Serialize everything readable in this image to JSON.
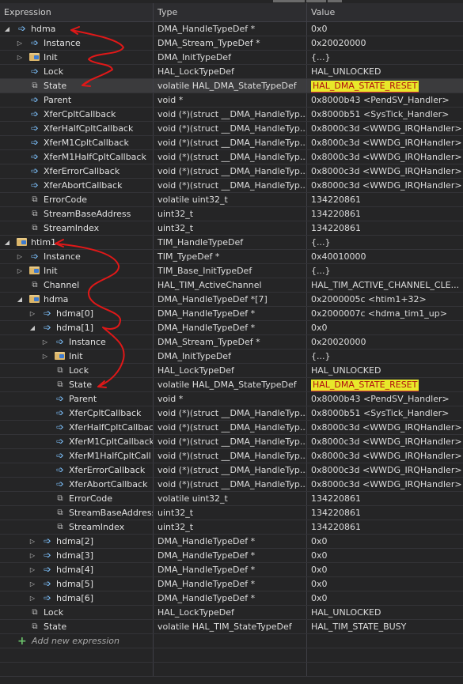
{
  "headers": {
    "expression": "Expression",
    "type": "Type",
    "value": "Value"
  },
  "add_new_expression": "Add new expression",
  "rows": [
    {
      "depth": 0,
      "exp": "open",
      "icon": "pointer",
      "name": "hdma",
      "type": "DMA_HandleTypeDef *",
      "value": "0x0"
    },
    {
      "depth": 1,
      "exp": "closed",
      "icon": "pointer",
      "name": "Instance",
      "type": "DMA_Stream_TypeDef *",
      "value": "0x20020000"
    },
    {
      "depth": 1,
      "exp": "closed",
      "icon": "struct",
      "name": "Init",
      "type": "DMA_InitTypeDef",
      "value": "{...}"
    },
    {
      "depth": 1,
      "exp": "none",
      "icon": "pointer",
      "name": "Lock",
      "type": "HAL_LockTypeDef",
      "value": "HAL_UNLOCKED"
    },
    {
      "depth": 1,
      "exp": "none",
      "icon": "field",
      "name": "State",
      "type": "volatile HAL_DMA_StateTypeDef",
      "value": "HAL_DMA_STATE_RESET",
      "selected": true,
      "highlight": true
    },
    {
      "depth": 1,
      "exp": "none",
      "icon": "pointer",
      "name": "Parent",
      "type": "void *",
      "value": "0x8000b43 <PendSV_Handler>"
    },
    {
      "depth": 1,
      "exp": "none",
      "icon": "pointer",
      "name": "XferCpltCallback",
      "type": "void (*)(struct __DMA_HandleTyp...",
      "value": "0x8000b51 <SysTick_Handler>"
    },
    {
      "depth": 1,
      "exp": "none",
      "icon": "pointer",
      "name": "XferHalfCpltCallback",
      "type": "void (*)(struct __DMA_HandleTyp...",
      "value": "0x8000c3d <WWDG_IRQHandler>"
    },
    {
      "depth": 1,
      "exp": "none",
      "icon": "pointer",
      "name": "XferM1CpltCallback",
      "type": "void (*)(struct __DMA_HandleTyp...",
      "value": "0x8000c3d <WWDG_IRQHandler>"
    },
    {
      "depth": 1,
      "exp": "none",
      "icon": "pointer",
      "name": "XferM1HalfCpltCallback",
      "type": "void (*)(struct __DMA_HandleTyp...",
      "value": "0x8000c3d <WWDG_IRQHandler>"
    },
    {
      "depth": 1,
      "exp": "none",
      "icon": "pointer",
      "name": "XferErrorCallback",
      "type": "void (*)(struct __DMA_HandleTyp...",
      "value": "0x8000c3d <WWDG_IRQHandler>"
    },
    {
      "depth": 1,
      "exp": "none",
      "icon": "pointer",
      "name": "XferAbortCallback",
      "type": "void (*)(struct __DMA_HandleTyp...",
      "value": "0x8000c3d <WWDG_IRQHandler>"
    },
    {
      "depth": 1,
      "exp": "none",
      "icon": "field",
      "name": "ErrorCode",
      "type": "volatile uint32_t",
      "value": "134220861"
    },
    {
      "depth": 1,
      "exp": "none",
      "icon": "field",
      "name": "StreamBaseAddress",
      "type": "uint32_t",
      "value": "134220861"
    },
    {
      "depth": 1,
      "exp": "none",
      "icon": "field",
      "name": "StreamIndex",
      "type": "uint32_t",
      "value": "134220861"
    },
    {
      "depth": 0,
      "exp": "open",
      "icon": "struct",
      "name": "htim1",
      "type": "TIM_HandleTypeDef",
      "value": "{...}"
    },
    {
      "depth": 1,
      "exp": "closed",
      "icon": "pointer",
      "name": "Instance",
      "type": "TIM_TypeDef *",
      "value": "0x40010000"
    },
    {
      "depth": 1,
      "exp": "closed",
      "icon": "struct",
      "name": "Init",
      "type": "TIM_Base_InitTypeDef",
      "value": "{...}"
    },
    {
      "depth": 1,
      "exp": "none",
      "icon": "field",
      "name": "Channel",
      "type": "HAL_TIM_ActiveChannel",
      "value": "HAL_TIM_ACTIVE_CHANNEL_CLE..."
    },
    {
      "depth": 1,
      "exp": "open",
      "icon": "struct",
      "name": "hdma",
      "type": "DMA_HandleTypeDef *[7]",
      "value": "0x2000005c <htim1+32>"
    },
    {
      "depth": 2,
      "exp": "closed",
      "icon": "pointer",
      "name": "hdma[0]",
      "type": "DMA_HandleTypeDef *",
      "value": "0x2000007c <hdma_tim1_up>"
    },
    {
      "depth": 2,
      "exp": "open",
      "icon": "pointer",
      "name": "hdma[1]",
      "type": "DMA_HandleTypeDef *",
      "value": "0x0"
    },
    {
      "depth": 3,
      "exp": "closed",
      "icon": "pointer",
      "name": "Instance",
      "type": "DMA_Stream_TypeDef *",
      "value": "0x20020000"
    },
    {
      "depth": 3,
      "exp": "closed",
      "icon": "struct",
      "name": "Init",
      "type": "DMA_InitTypeDef",
      "value": "{...}"
    },
    {
      "depth": 3,
      "exp": "none",
      "icon": "field",
      "name": "Lock",
      "type": "HAL_LockTypeDef",
      "value": "HAL_UNLOCKED"
    },
    {
      "depth": 3,
      "exp": "none",
      "icon": "field",
      "name": "State",
      "type": "volatile HAL_DMA_StateTypeDef",
      "value": "HAL_DMA_STATE_RESET",
      "highlight": true
    },
    {
      "depth": 3,
      "exp": "none",
      "icon": "pointer",
      "name": "Parent",
      "type": "void *",
      "value": "0x8000b43 <PendSV_Handler>"
    },
    {
      "depth": 3,
      "exp": "none",
      "icon": "pointer",
      "name": "XferCpltCallback",
      "type": "void (*)(struct __DMA_HandleTyp...",
      "value": "0x8000b51 <SysTick_Handler>"
    },
    {
      "depth": 3,
      "exp": "none",
      "icon": "pointer",
      "name": "XferHalfCpltCallbac",
      "type": "void (*)(struct __DMA_HandleTyp...",
      "value": "0x8000c3d <WWDG_IRQHandler>"
    },
    {
      "depth": 3,
      "exp": "none",
      "icon": "pointer",
      "name": "XferM1CpltCallback",
      "type": "void (*)(struct __DMA_HandleTyp...",
      "value": "0x8000c3d <WWDG_IRQHandler>"
    },
    {
      "depth": 3,
      "exp": "none",
      "icon": "pointer",
      "name": "XferM1HalfCpltCall",
      "type": "void (*)(struct __DMA_HandleTyp...",
      "value": "0x8000c3d <WWDG_IRQHandler>"
    },
    {
      "depth": 3,
      "exp": "none",
      "icon": "pointer",
      "name": "XferErrorCallback",
      "type": "void (*)(struct __DMA_HandleTyp...",
      "value": "0x8000c3d <WWDG_IRQHandler>"
    },
    {
      "depth": 3,
      "exp": "none",
      "icon": "pointer",
      "name": "XferAbortCallback",
      "type": "void (*)(struct __DMA_HandleTyp...",
      "value": "0x8000c3d <WWDG_IRQHandler>"
    },
    {
      "depth": 3,
      "exp": "none",
      "icon": "field",
      "name": "ErrorCode",
      "type": "volatile uint32_t",
      "value": "134220861"
    },
    {
      "depth": 3,
      "exp": "none",
      "icon": "field",
      "name": "StreamBaseAddress",
      "type": "uint32_t",
      "value": "134220861"
    },
    {
      "depth": 3,
      "exp": "none",
      "icon": "field",
      "name": "StreamIndex",
      "type": "uint32_t",
      "value": "134220861"
    },
    {
      "depth": 2,
      "exp": "closed",
      "icon": "pointer",
      "name": "hdma[2]",
      "type": "DMA_HandleTypeDef *",
      "value": "0x0"
    },
    {
      "depth": 2,
      "exp": "closed",
      "icon": "pointer",
      "name": "hdma[3]",
      "type": "DMA_HandleTypeDef *",
      "value": "0x0"
    },
    {
      "depth": 2,
      "exp": "closed",
      "icon": "pointer",
      "name": "hdma[4]",
      "type": "DMA_HandleTypeDef *",
      "value": "0x0"
    },
    {
      "depth": 2,
      "exp": "closed",
      "icon": "pointer",
      "name": "hdma[5]",
      "type": "DMA_HandleTypeDef *",
      "value": "0x0"
    },
    {
      "depth": 2,
      "exp": "closed",
      "icon": "pointer",
      "name": "hdma[6]",
      "type": "DMA_HandleTypeDef *",
      "value": "0x0"
    },
    {
      "depth": 1,
      "exp": "none",
      "icon": "field",
      "name": "Lock",
      "type": "HAL_LockTypeDef",
      "value": "HAL_UNLOCKED"
    },
    {
      "depth": 1,
      "exp": "none",
      "icon": "field",
      "name": "State",
      "type": "volatile HAL_TIM_StateTypeDef",
      "value": "HAL_TIM_STATE_BUSY"
    }
  ],
  "colors": {
    "annotation_red": "#e01818",
    "highlight": "#e8e82a",
    "highlight_text": "#b01010"
  }
}
